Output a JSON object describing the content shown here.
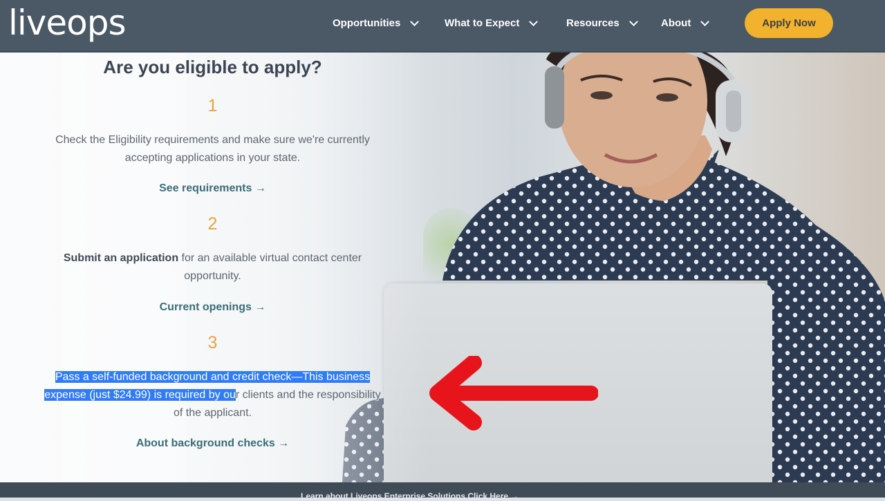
{
  "nav": {
    "logo": "liveops",
    "items": [
      {
        "label": "Opportunities"
      },
      {
        "label": "What to Expect"
      },
      {
        "label": "Resources"
      },
      {
        "label": "About"
      }
    ],
    "apply": "Apply Now"
  },
  "eligibility": {
    "heading": "Are you eligible to apply?",
    "steps": [
      {
        "number": "1",
        "line1": "Check the Eligibility requirements and make sure we're currently",
        "line2": "accepting applications in your state.",
        "link": "See requirements →"
      },
      {
        "number": "2",
        "bold": "Submit an application",
        "line1_rest": " for an available virtual contact center",
        "line2": "opportunity.",
        "link": "Current openings →"
      },
      {
        "number": "3",
        "selected_line1": "Pass a self-funded background and credit check—This business",
        "selected_line2": "expense (just $24.99) is required by ou",
        "line2_rest": "r clients and the responsibility",
        "line3": "of the applicant.",
        "link": "About background checks →"
      }
    ]
  },
  "footer": {
    "text": "Learn about Liveops Enterprise Solutions Click Here →"
  },
  "colors": {
    "nav_bg": "#4b5866",
    "apply_bg": "#f2b22e",
    "step_number": "#e9a33e",
    "link": "#3a6d78",
    "selection": "#2f7cf6",
    "arrow": "#e8141b"
  }
}
